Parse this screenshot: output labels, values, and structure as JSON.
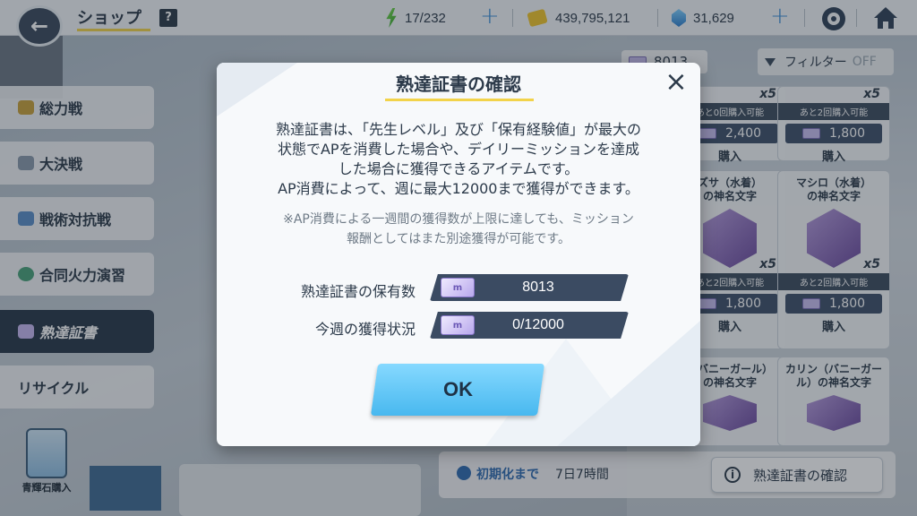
{
  "topbar": {
    "back_icon": "arrow-left-icon",
    "title": "ショップ",
    "help_label": "?",
    "ap": "17/232",
    "credits": "439,795,121",
    "pyroxene": "31,629",
    "plus": "+"
  },
  "menu": {
    "items": [
      {
        "label": "総力戦"
      },
      {
        "label": "大決戦"
      },
      {
        "label": "戦術対抗戦"
      },
      {
        "label": "合同火力演習"
      },
      {
        "label": "熟達証書",
        "active": true
      },
      {
        "label": "リサイクル"
      }
    ],
    "pyroxene_purchase": "青輝石購入"
  },
  "grid": {
    "count": "8013",
    "filter_label": "フィルター",
    "filter_state": "OFF",
    "cards": [
      {
        "name": "",
        "x": "x5",
        "remain": "あと0回購入可能",
        "price": "2,400",
        "buy": "購入"
      },
      {
        "name": "",
        "x": "x5",
        "remain": "あと2回購入可能",
        "price": "1,800",
        "buy": "購入"
      },
      {
        "name": "ズサ（水着）\nの神名文字",
        "x": "x5",
        "remain": "あと2回購入可能",
        "price": "1,800",
        "buy": "購入"
      },
      {
        "name": "マシロ（水着）\nの神名文字",
        "x": "x5",
        "remain": "あと2回購入可能",
        "price": "1,800",
        "buy": "購入"
      },
      {
        "name": "（バニーガール）\nの神名文字",
        "x": "",
        "remain": "",
        "price": "",
        "buy": ""
      },
      {
        "name": "カリン（バニーガール）の神名文字",
        "x": "",
        "remain": "",
        "price": "",
        "buy": ""
      }
    ]
  },
  "bottom": {
    "reset_label": "初期化まで",
    "reset_time": "7日7時間",
    "confirm_button": "熟達証書の確認"
  },
  "modal": {
    "title": "熟達証書の確認",
    "close": "×",
    "desc_1": "熟達証書は、「先生レベル」及び「保有経験値」が最大の",
    "desc_2": "状態でAPを消費した場合や、デイリーミッションを達成",
    "desc_3": "した場合に獲得できるアイテムです。",
    "desc_4": "AP消費によって、週に最大12000まで獲得ができます。",
    "note_1": "※AP消費による一週間の獲得数が上限に達しても、ミッション",
    "note_2": "報酬としてはまた別途獲得が可能です。",
    "owned_label": "熟達証書の保有数",
    "owned_value": "8013",
    "weekly_label": "今週の獲得状況",
    "weekly_value": "0/12000",
    "ok": "OK"
  },
  "colors": {
    "accent_yellow": "#f2d34a",
    "dark_navy": "#2c3a4a",
    "ok_blue": "#48b8ef",
    "link_blue": "#2f6bb0"
  }
}
